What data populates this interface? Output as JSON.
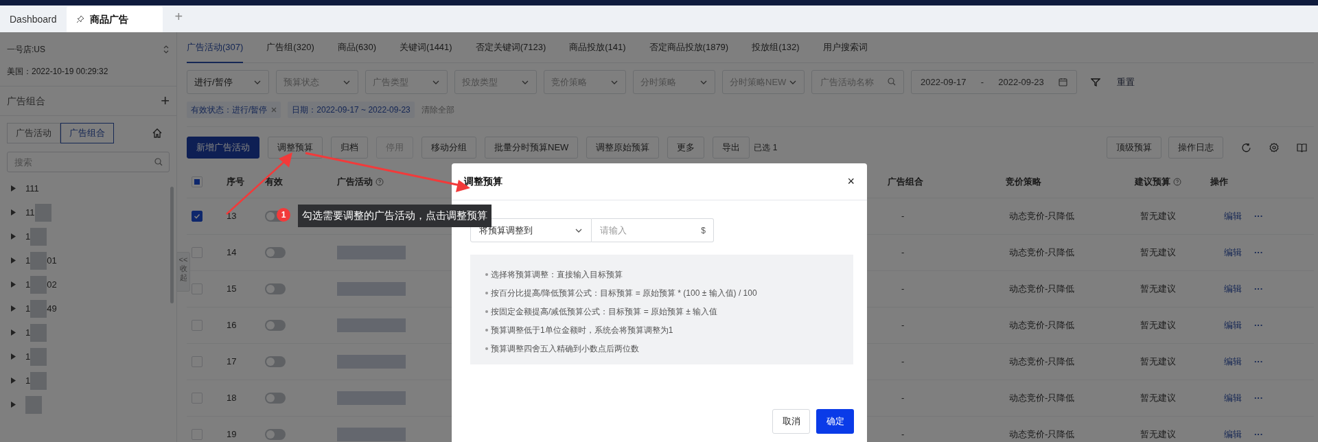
{
  "browser_tabs": [
    {
      "label": "Dashboard",
      "selected": false,
      "pinned": false
    },
    {
      "label": "商品广告",
      "selected": true,
      "pinned": true
    }
  ],
  "new_tab": "+",
  "sidebar": {
    "store": "一号店:US",
    "time": "美国：2022-10-19 00:29:32",
    "section_title": "广告组合",
    "add": "+",
    "toggle": [
      {
        "label": "广告活动",
        "selected": false
      },
      {
        "label": "广告组合",
        "selected": true
      }
    ],
    "search_placeholder": "搜索",
    "tree": [
      {
        "label": "111",
        "blurred": false
      },
      {
        "label": "11",
        "blurred": true
      },
      {
        "label": "1",
        "blurred": true
      },
      {
        "label": "1",
        "blurred": true,
        "suffix": "01"
      },
      {
        "label": "1",
        "blurred": true,
        "suffix": "02"
      },
      {
        "label": "1",
        "blurred": true,
        "suffix": "49"
      },
      {
        "label": "1",
        "blurred": true
      },
      {
        "label": "1",
        "blurred": true
      },
      {
        "label": "1",
        "blurred": true
      },
      {
        "blurred": true
      }
    ],
    "collapse_arrows": "<<",
    "collapse": "收起"
  },
  "tabs": [
    {
      "label": "广告活动(307)",
      "selected": true
    },
    {
      "label": "广告组(320)",
      "selected": false
    },
    {
      "label": "商品(630)",
      "selected": false
    },
    {
      "label": "关键词(1441)",
      "selected": false
    },
    {
      "label": "否定关键词(7123)",
      "selected": false
    },
    {
      "label": "商品投放(141)",
      "selected": false
    },
    {
      "label": "否定商品投放(1879)",
      "selected": false
    },
    {
      "label": "投放组(132)",
      "selected": false
    },
    {
      "label": "用户搜索词",
      "selected": false
    }
  ],
  "filters": [
    {
      "kind": "value",
      "text": "进行/暂停"
    },
    {
      "kind": "placeholder",
      "text": "预算状态"
    },
    {
      "kind": "placeholder",
      "text": "广告类型"
    },
    {
      "kind": "placeholder",
      "text": "投放类型"
    },
    {
      "kind": "placeholder",
      "text": "竞价策略"
    },
    {
      "kind": "placeholder",
      "text": "分时策略"
    },
    {
      "kind": "placeholder",
      "text": "分时策略NEW"
    }
  ],
  "search": {
    "placeholder": "广告活动名称"
  },
  "date_range": {
    "start": "2022-09-17",
    "separator": "-",
    "end": "2022-09-23"
  },
  "reset": "重置",
  "chips": [
    {
      "label": "有效状态：进行/暂停",
      "removable": true
    },
    {
      "label": "日期：2022-09-17 ~ 2022-09-23",
      "removable": false
    }
  ],
  "clear_all": "清除全部",
  "toolbar": [
    {
      "label": "新增广告活动",
      "kind": "primary"
    },
    {
      "label": "调整预算",
      "kind": "default"
    },
    {
      "label": "归档",
      "kind": "default"
    },
    {
      "label": "停用",
      "kind": "disabled"
    },
    {
      "label": "移动分组",
      "kind": "default"
    },
    {
      "label": "批量分时预算NEW",
      "kind": "default"
    },
    {
      "label": "调整原始预算",
      "kind": "default"
    },
    {
      "label": "更多",
      "kind": "default"
    },
    {
      "label": "导出",
      "kind": "default"
    }
  ],
  "selected_count": "已选 1",
  "toolbar_right": [
    "顶级预算",
    "操作日志"
  ],
  "table": {
    "select_all_indeterminate": true,
    "columns": [
      "序号",
      "有效",
      "广告活动",
      "广告组合",
      "竞价策略",
      "建议预算",
      "操作"
    ],
    "rows": [
      {
        "selected": true,
        "index": "13",
        "active": false,
        "campaign_hidden": true,
        "group": "-",
        "strategy": "动态竞价-只降低",
        "suggestion": "暂无建议",
        "action": "编辑",
        "more": "···"
      },
      {
        "selected": false,
        "index": "14",
        "active": false,
        "group": "-",
        "strategy": "动态竞价-只降低",
        "suggestion": "暂无建议",
        "action": "编辑",
        "more": "···"
      },
      {
        "selected": false,
        "index": "15",
        "active": false,
        "group": "-",
        "strategy": "动态竞价-只降低",
        "suggestion": "暂无建议",
        "action": "编辑",
        "more": "···"
      },
      {
        "selected": false,
        "index": "16",
        "active": false,
        "group": "-",
        "strategy": "动态竞价-只降低",
        "suggestion": "暂无建议",
        "action": "编辑",
        "more": "···"
      },
      {
        "selected": false,
        "index": "17",
        "active": false,
        "group": "-",
        "strategy": "动态竞价-只降低",
        "suggestion": "暂无建议",
        "action": "编辑",
        "more": "···"
      },
      {
        "selected": false,
        "index": "18",
        "active": false,
        "group": "-",
        "strategy": "动态竞价-只降低",
        "suggestion": "暂无建议",
        "action": "编辑",
        "more": "···"
      },
      {
        "selected": false,
        "index": "19",
        "active": false,
        "group": "-",
        "strategy": "动态竞价-只降低",
        "suggestion": "暂无建议",
        "action": "编辑",
        "more": "···"
      }
    ]
  },
  "modal": {
    "title": "调整预算",
    "close": "×",
    "mode": "将预算调整到",
    "input_placeholder": "请输入",
    "suffix": "$",
    "notes": [
      "选择将预算调整：直接输入目标预算",
      "按百分比提高/降低预算公式：目标预算 = 原始预算 * (100 ± 输入值) / 100",
      "按固定金额提高/减低预算公式：目标预算 = 原始预算 ± 输入值",
      "预算调整低于1单位金额时，系统会将预算调整为1",
      "预算调整四舍五入精确到小数点后两位数"
    ],
    "cancel": "取消",
    "confirm": "确定"
  },
  "annotation": {
    "number": "1",
    "text": "勾选需要调整的广告活动，点击调整预算"
  }
}
